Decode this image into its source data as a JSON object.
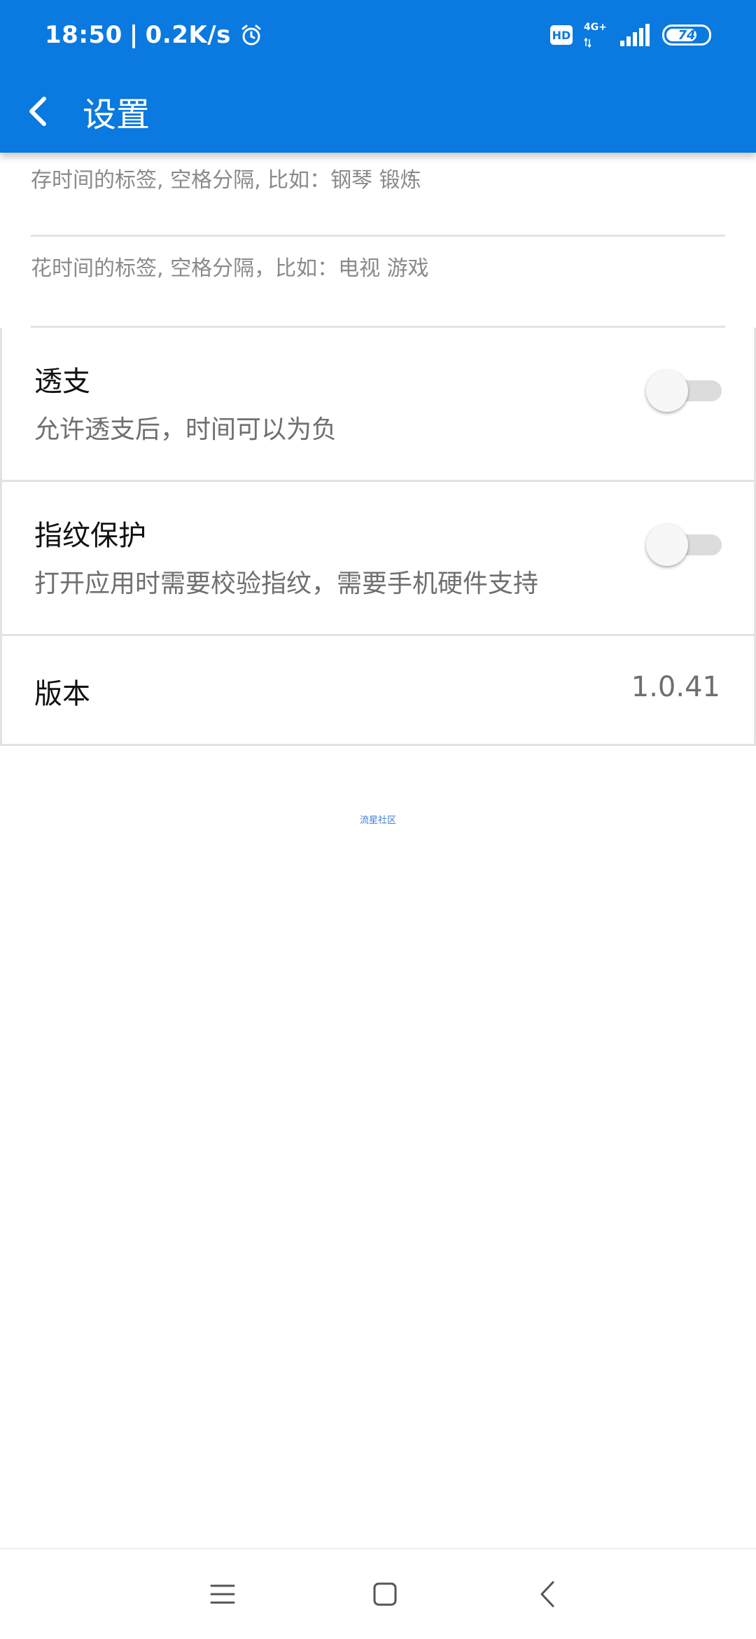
{
  "status_bar": {
    "time": "18:50",
    "separator": "|",
    "net_speed": "0.2K/s",
    "hd_label": "HD",
    "network_type": "4G+",
    "battery_level": "74"
  },
  "app_bar": {
    "title": "设置",
    "back_icon": "chevron-left-icon"
  },
  "tags": {
    "saving_placeholder": "存时间的标签, 空格分隔, 比如：钢琴 锻炼",
    "spending_placeholder": "花时间的标签, 空格分隔，比如：电视 游戏"
  },
  "settings": [
    {
      "title": "透支",
      "description": "允许透支后，时间可以为负",
      "enabled": false
    },
    {
      "title": "指纹保护",
      "description": "打开应用时需要校验指纹，需要手机硬件支持",
      "enabled": false
    }
  ],
  "version": {
    "label": "版本",
    "value": "1.0.41"
  },
  "footer": {
    "community_link": "流星社区"
  },
  "colors": {
    "primary": "#0a79e0",
    "toggle_track_off": "#dcdcdc",
    "link": "#3d7fd8"
  },
  "nav_bar": {
    "menu_icon": "menu-icon",
    "home_icon": "home-square-icon",
    "back_icon": "back-triangle-icon"
  }
}
